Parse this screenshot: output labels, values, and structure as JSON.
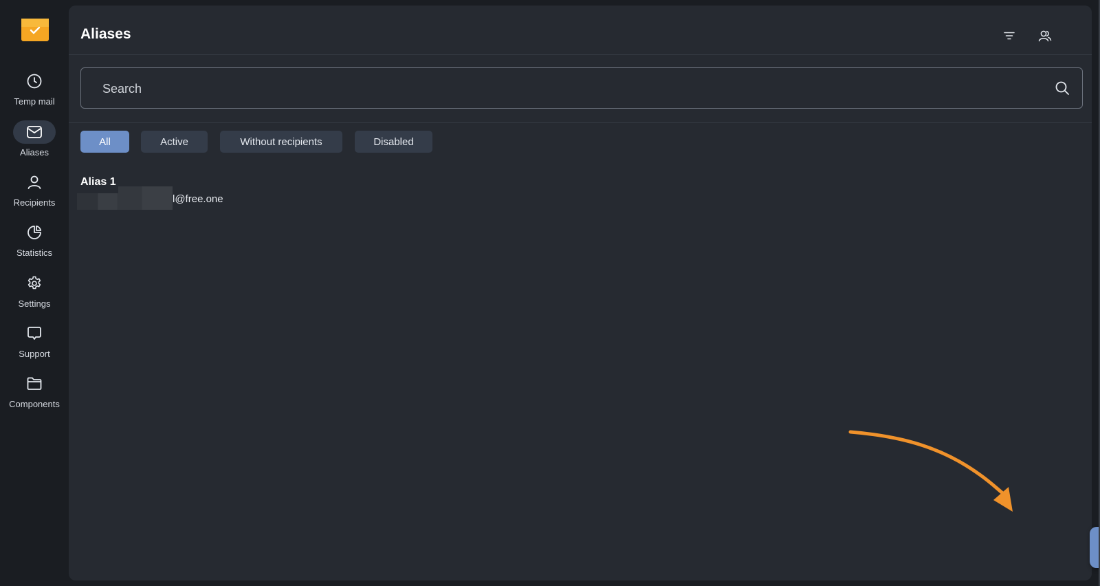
{
  "sidebar": {
    "logo": "mail-check-logo",
    "items": [
      {
        "label": "Temp mail",
        "icon": "clock-icon",
        "active": false
      },
      {
        "label": "Aliases",
        "icon": "mail-icon",
        "active": true
      },
      {
        "label": "Recipients",
        "icon": "user-icon",
        "active": false
      },
      {
        "label": "Statistics",
        "icon": "pie-chart-icon",
        "active": false
      },
      {
        "label": "Settings",
        "icon": "gear-icon",
        "active": false
      },
      {
        "label": "Support",
        "icon": "chat-icon",
        "active": false
      },
      {
        "label": "Components",
        "icon": "folder-icon",
        "active": false
      }
    ]
  },
  "header": {
    "title": "Aliases",
    "icons": [
      "filter-icon",
      "users-icon"
    ]
  },
  "search": {
    "placeholder": "Search",
    "value": ""
  },
  "filters": [
    {
      "label": "All",
      "active": true
    },
    {
      "label": "Active",
      "active": false
    },
    {
      "label": "Without recipients",
      "active": false
    },
    {
      "label": "Disabled",
      "active": false
    }
  ],
  "aliases": [
    {
      "name": "Alias 1",
      "email_visible": "l@free.one"
    }
  ],
  "fab": {
    "icon": "plus-icon"
  },
  "colors": {
    "accent": "#6d8fc7",
    "panel": "#262a31",
    "background": "#1a1d22",
    "logo": "#f5a623",
    "annotation_arrow": "#f0922b"
  }
}
